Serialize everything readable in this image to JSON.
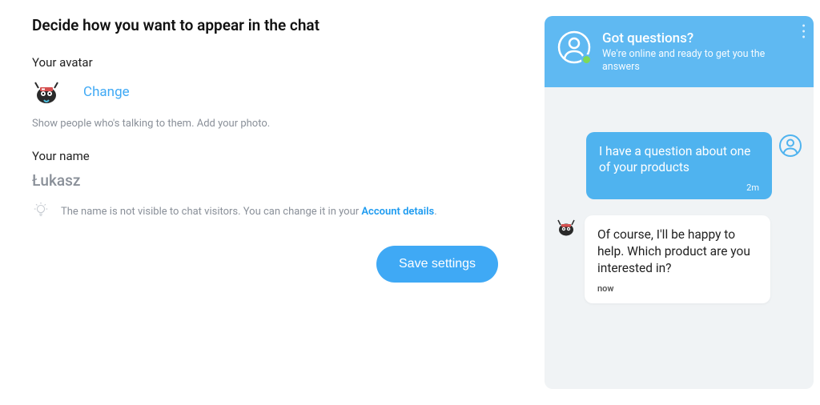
{
  "page_title": "Decide how you want to appear in the chat",
  "avatar": {
    "label": "Your avatar",
    "change_label": "Change",
    "hint": "Show people who's talking to them. Add your photo."
  },
  "name": {
    "label": "Your name",
    "value": "Łukasz",
    "hint_prefix": "The name is not visible to chat visitors. You can change it in your ",
    "hint_link": "Account details",
    "hint_suffix": "."
  },
  "save_button": "Save settings",
  "chat_preview": {
    "header": {
      "title": "Got questions?",
      "subtitle": "We're online and ready to get you the answers"
    },
    "messages": {
      "visitor": {
        "text": "I have a question about one of your products",
        "time": "2m"
      },
      "agent": {
        "text": "Of course, I'll be happy to help. Which product are you interested in?",
        "time": "now"
      }
    }
  }
}
